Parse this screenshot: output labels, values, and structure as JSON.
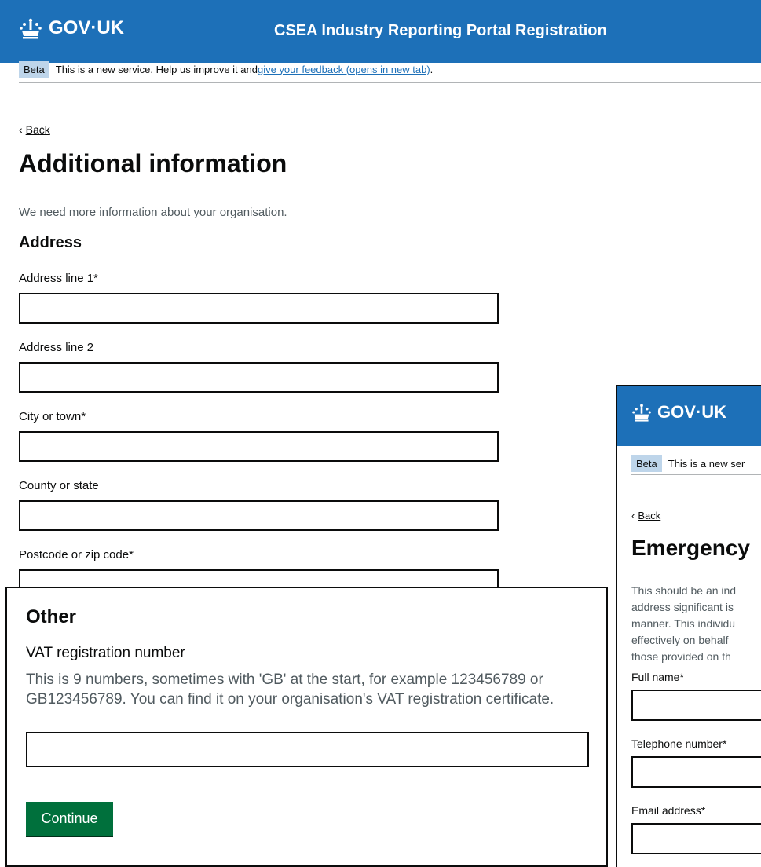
{
  "main": {
    "header": {
      "logo_text": "GOV·UK",
      "service_name": "CSEA Industry Reporting Portal Registration"
    },
    "beta": {
      "tag": "Beta",
      "text": "This is a new service. Help us improve it and ",
      "link": "give your feedback (opens in new tab)",
      "suffix": "."
    },
    "back": {
      "label": "Back"
    },
    "title": "Additional information",
    "lead": "We need more information about your organisation.",
    "section_heading": "Address",
    "fields": [
      {
        "label": "Address line 1*"
      },
      {
        "label": "Address line 2"
      },
      {
        "label": "City or town*"
      },
      {
        "label": "County or state"
      },
      {
        "label": "Postcode or zip code*"
      }
    ]
  },
  "other": {
    "heading": "Other",
    "vat_label": "VAT registration number",
    "vat_hint": "This is 9 numbers, sometimes with 'GB' at the start, for example 123456789 or GB123456789. You can find it on your organisation's VAT registration certificate.",
    "continue_label": "Continue"
  },
  "side": {
    "header": {
      "logo_text": "GOV·UK"
    },
    "beta": {
      "tag": "Beta",
      "text": "This is a new ser"
    },
    "back": {
      "label": "Back"
    },
    "title": "Emergency",
    "body_lines": [
      "This should be an ind",
      "address significant is",
      "manner. This individu",
      "effectively on behalf",
      "those provided on th"
    ],
    "fields": [
      {
        "label": "Full name*"
      },
      {
        "label": "Telephone number*"
      },
      {
        "label": "Email address*"
      }
    ]
  }
}
